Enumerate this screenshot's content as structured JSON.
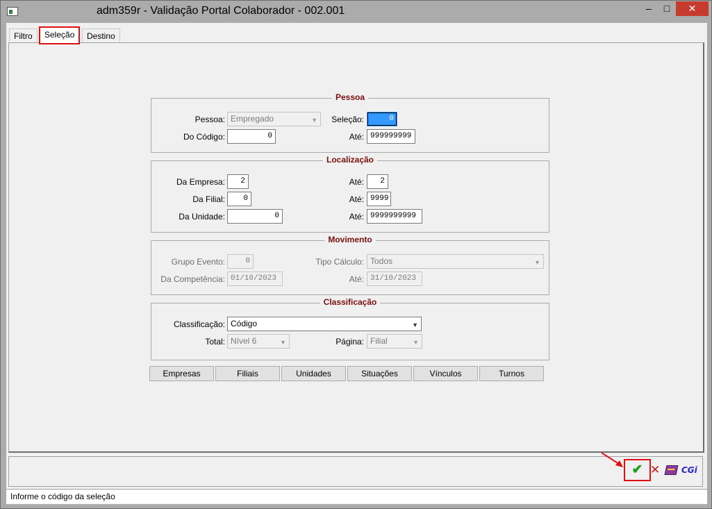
{
  "window": {
    "title": "adm359r - Validação Portal Colaborador - 002.001",
    "minimize": "–",
    "maximize": "□",
    "close": "✕"
  },
  "tabs": [
    {
      "label": "Filtro",
      "active": false
    },
    {
      "label": "Seleção",
      "active": true
    },
    {
      "label": "Destino",
      "active": false
    }
  ],
  "pessoa": {
    "title": "Pessoa",
    "pessoa_label": "Pessoa:",
    "pessoa_value": "Empregado",
    "selecao_label": "Seleção:",
    "selecao_value": "0",
    "do_codigo_label": "Do Código:",
    "do_codigo_value": "0",
    "ate_label": "Até:",
    "ate_value": "999999999"
  },
  "localizacao": {
    "title": "Localização",
    "da_empresa_label": "Da Empresa:",
    "da_empresa_value": "2",
    "ate_empresa_label": "Até:",
    "ate_empresa_value": "2",
    "da_filial_label": "Da Filial:",
    "da_filial_value": "0",
    "ate_filial_label": "Até:",
    "ate_filial_value": "9999",
    "da_unidade_label": "Da Unidade:",
    "da_unidade_value": "0",
    "ate_unidade_label": "Até:",
    "ate_unidade_value": "9999999999"
  },
  "movimento": {
    "title": "Movimento",
    "grupo_evento_label": "Grupo Evento:",
    "grupo_evento_value": "0",
    "tipo_calculo_label": "Tipo Cálculo:",
    "tipo_calculo_value": "Todos",
    "da_competencia_label": "Da Competência:",
    "da_competencia_value": "01/10/2023",
    "ate_label": "Até:",
    "ate_value": "31/10/2023"
  },
  "classificacao": {
    "title": "Classificação",
    "classificacao_label": "Classificação:",
    "classificacao_value": "Código",
    "total_label": "Total:",
    "total_value": "Nível 6",
    "pagina_label": "Página:",
    "pagina_value": "Filial"
  },
  "buttons": {
    "empresas": "Empresas",
    "filiais": "Filiais",
    "unidades": "Unidades",
    "situacoes": "Situações",
    "vinculos": "Vínculos",
    "turnos": "Turnos"
  },
  "toolbar": {
    "ok_icon": "✔",
    "cancel_icon": "✕",
    "cgi_label": "CGi"
  },
  "status": {
    "text": "Informe o código da seleção"
  },
  "colors": {
    "group_title": "#7a0e0e",
    "highlight": "#e01010",
    "selection": "#3399ff",
    "ok_green": "#19a01b",
    "cgi_blue": "#2424c8"
  }
}
